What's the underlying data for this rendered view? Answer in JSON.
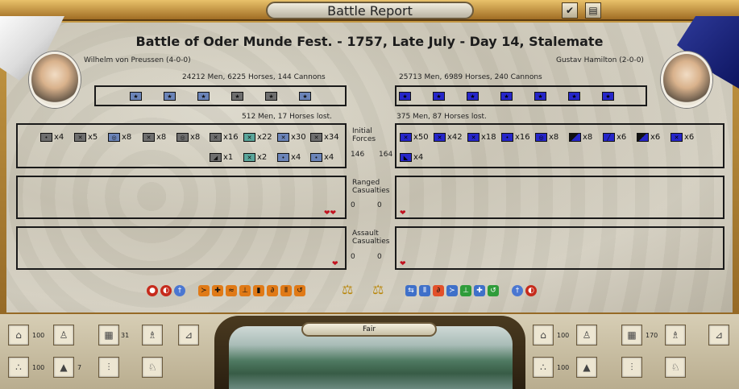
{
  "window": {
    "title": "Battle Report",
    "check_icon": "✔",
    "journal_icon": "▤"
  },
  "battle": {
    "heading": "Battle of Oder Munde Fest. - 1757, Late July - Day 14, Stalemate"
  },
  "left": {
    "commander": "Wilhelm von Preussen (4-0-0)",
    "forces": "24212 Men, 6225 Horses, 144 Cannons",
    "lost": "512 Men, 17 Horses lost.",
    "units": [
      {
        "x": "x4"
      },
      {
        "x": "x5"
      },
      {
        "x": "x8"
      },
      {
        "x": "x8"
      },
      {
        "x": "x8"
      },
      {
        "x": "x16"
      },
      {
        "x": "x22"
      },
      {
        "x": "x30"
      },
      {
        "x": "x34"
      },
      {
        "x": "x1"
      },
      {
        "x": "x2"
      },
      {
        "x": "x4"
      },
      {
        "x": "x4"
      }
    ],
    "initial_num": "146",
    "ranged_num": "0",
    "assault_num": "0"
  },
  "right": {
    "commander": "Gustav Hamilton (2-0-0)",
    "forces": "25713 Men, 6989 Horses, 240 Cannons",
    "lost": "375 Men, 87 Horses lost.",
    "units": [
      {
        "x": "x50"
      },
      {
        "x": "x42"
      },
      {
        "x": "x18"
      },
      {
        "x": "x16"
      },
      {
        "x": "x8"
      },
      {
        "x": "x8"
      },
      {
        "x": "x6"
      },
      {
        "x": "x6"
      },
      {
        "x": "x6"
      },
      {
        "x": "x4"
      }
    ],
    "initial_num": "164",
    "ranged_num": "0",
    "assault_num": "0"
  },
  "labels": {
    "initial": "Initial Forces",
    "ranged": "Ranged Casualties",
    "assault": "Assault Casualties"
  },
  "bottom": {
    "weather": "Fair",
    "left_slots": [
      {
        "n": "100"
      },
      {
        "n": ""
      },
      {
        "n": "31"
      },
      {
        "n": ""
      },
      {
        "n": ""
      },
      {
        "n": "100"
      },
      {
        "n": "7"
      },
      {
        "n": ""
      },
      {
        "n": ""
      }
    ],
    "right_slots": [
      {
        "n": "100"
      },
      {
        "n": ""
      },
      {
        "n": "170"
      },
      {
        "n": ""
      },
      {
        "n": ""
      },
      {
        "n": "100"
      },
      {
        "n": ""
      },
      {
        "n": ""
      },
      {
        "n": ""
      }
    ]
  },
  "colors": {
    "prussia_unit": "#6b84b8",
    "sweden_unit": "#2626c9",
    "heart": "#c1121f"
  }
}
